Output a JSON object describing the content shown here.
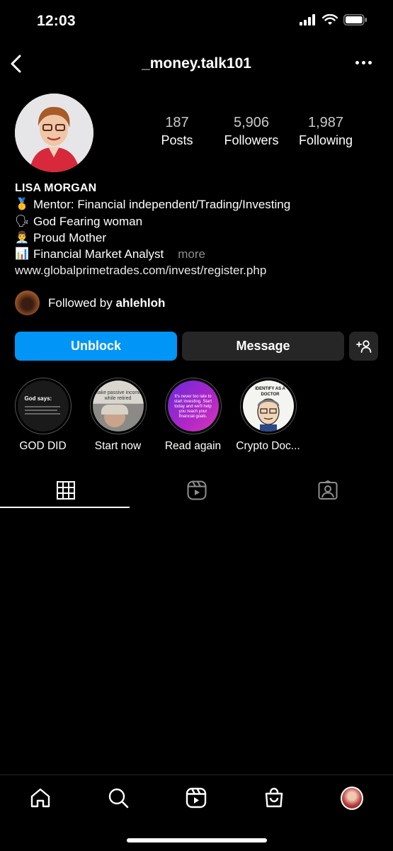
{
  "status_bar": {
    "time": "12:03"
  },
  "header": {
    "username": "_money.talk101"
  },
  "stats": [
    {
      "value": "187",
      "label": "Posts"
    },
    {
      "value": "5,906",
      "label": "Followers"
    },
    {
      "value": "1,987",
      "label": "Following"
    }
  ],
  "bio": {
    "name": "LISA MORGAN",
    "lines": [
      {
        "emoji": "🥇",
        "text": "Mentor: Financial independent/Trading/Investing"
      },
      {
        "emoji": "🗣",
        "text": "God Fearing woman"
      },
      {
        "emoji": "👨‍💼",
        "text": "Proud Mother"
      },
      {
        "emoji": "📊",
        "text": "Financial Market Analyst"
      }
    ],
    "more_label": "more",
    "link": "www.globalprimetrades.com/invest/register.php"
  },
  "followed_by": {
    "prefix": "Followed by",
    "user": "ahlehloh"
  },
  "buttons": {
    "unblock": "Unblock",
    "message": "Message"
  },
  "highlights": [
    {
      "label": "GOD DID",
      "cover_text": "God says:"
    },
    {
      "label": "Start now",
      "cover_text": "Make passive income while retired"
    },
    {
      "label": "Read again",
      "cover_text": "It's never too late to start investing. Start today and we'll help you reach your financial goals."
    },
    {
      "label": "Crypto Doc...",
      "cover_text": "IDENTIFY AS A DOCTOR"
    }
  ],
  "tabs": [
    {
      "icon": "grid-icon",
      "active": true
    },
    {
      "icon": "reels-icon",
      "active": false
    },
    {
      "icon": "tagged-icon",
      "active": false
    }
  ],
  "bottom_nav": [
    "home-icon",
    "search-icon",
    "reels-icon",
    "shop-icon",
    "profile-avatar"
  ],
  "colors": {
    "primary_button": "#0095f6",
    "secondary_button": "#262626",
    "background": "#000000"
  }
}
